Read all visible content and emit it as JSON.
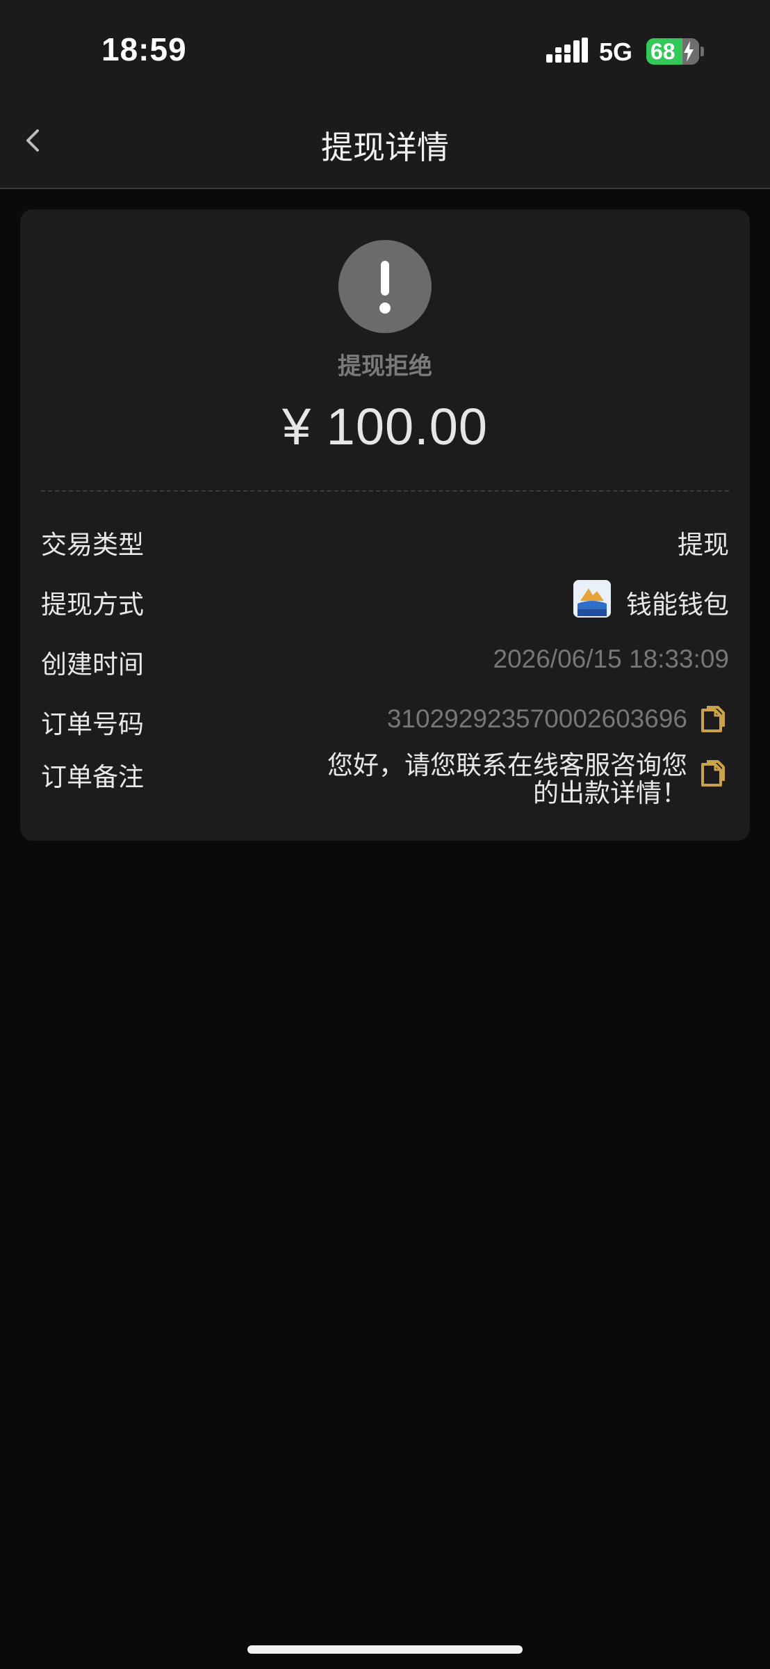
{
  "status_bar": {
    "time": "18:59",
    "network": "5G",
    "battery_percent": "68",
    "battery_level": 0.68
  },
  "nav": {
    "title": "提现详情"
  },
  "card": {
    "status_text": "提现拒绝",
    "amount": "¥ 100.00",
    "rows": [
      {
        "label": "交易类型",
        "value": "提现"
      },
      {
        "label": "提现方式",
        "value": "钱能钱包",
        "logo_text": "钱能钱包"
      },
      {
        "label": "创建时间",
        "value": "2026/06/15 18:33:09"
      },
      {
        "label": "订单号码",
        "value": "310292923570002603696"
      },
      {
        "label": "订单备注",
        "value": "您好，请您联系在线客服咨询您的出款详情！"
      }
    ]
  },
  "colors": {
    "background": "#0a0a0a",
    "bar": "#1b1b1b",
    "card": "#1c1c1c",
    "status_circle": "#6b6b6b",
    "copy_icon": "#c9a24a",
    "battery": "#34c759"
  },
  "icons": [
    "signal-icon",
    "battery-icon",
    "back-arrow-icon",
    "exclamation-icon",
    "wallet-logo-icon",
    "copy-icon"
  ]
}
